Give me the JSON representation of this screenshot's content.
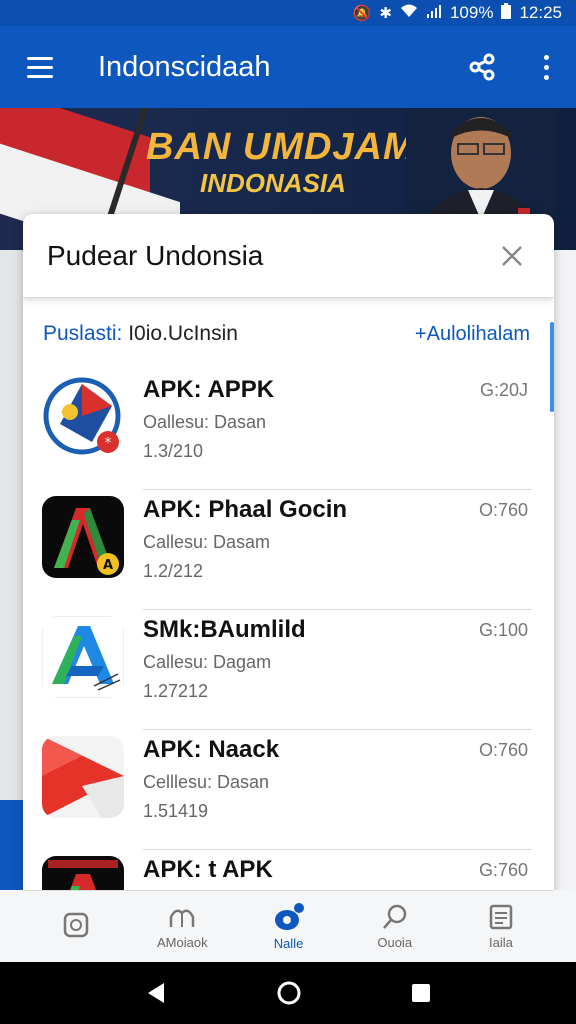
{
  "status_bar": {
    "battery": "109%",
    "time": "12:25"
  },
  "app_bar": {
    "title": "Indonscidaah"
  },
  "banner": {
    "line1": "BAN UMDJAM",
    "line2": "INDONASIA"
  },
  "sheet": {
    "title": "Pudear Undonsia",
    "publisher_label": "Puslasti:",
    "publisher_value": "I0io.UcInsin",
    "add_link": "+Aulolihalam"
  },
  "items": [
    {
      "title": "APK: APPK",
      "subtitle": "Oallesu: Dasan",
      "date": "1.3/210",
      "value": "G:20J",
      "icon": "kite-emblem-icon"
    },
    {
      "title": "APK: Phaal Gocin",
      "subtitle": "Callesu: Dasam",
      "date": "1.2/212",
      "value": "O:760",
      "icon": "a-letter-app-icon"
    },
    {
      "title": "SMk:BAumlild",
      "subtitle": "Callesu: Dagam",
      "date": "1.27212",
      "value": "G:100",
      "icon": "a-arrow-app-icon"
    },
    {
      "title": "APK: Naack",
      "subtitle": "Celllesu: Dasan",
      "date": "1.51419",
      "value": "O:760",
      "icon": "red-arrow-app-icon"
    },
    {
      "title": "APK: t APK",
      "subtitle": "",
      "date": "",
      "value": "G:760",
      "icon": "a-letter-dark-app-icon"
    }
  ],
  "bottom_nav": [
    {
      "label": "",
      "icon": "gallery-icon"
    },
    {
      "label": "AMoiaok",
      "icon": "hat-icon"
    },
    {
      "label": "Nalle",
      "icon": "chat-dot-icon"
    },
    {
      "label": "Ouoia",
      "icon": "search-icon"
    },
    {
      "label": "Iaila",
      "icon": "document-icon"
    }
  ],
  "colors": {
    "primary": "#0d57be",
    "accent_gold": "#f4b53c"
  }
}
